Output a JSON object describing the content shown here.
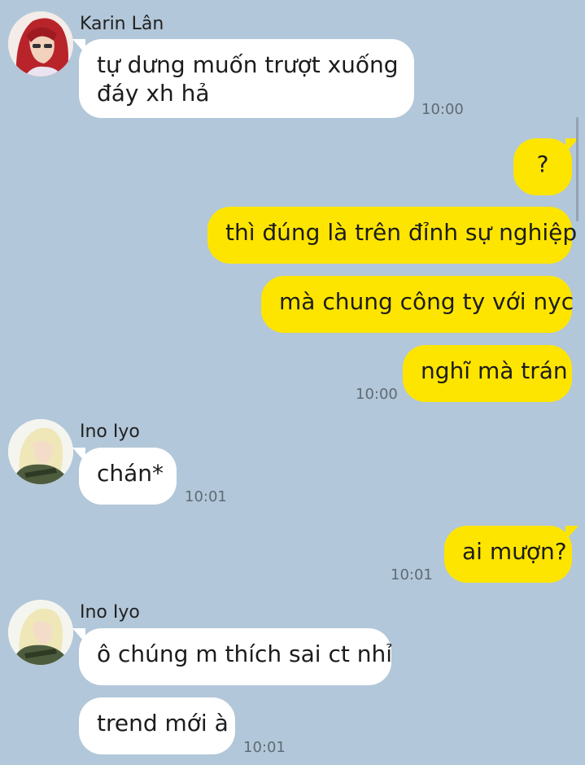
{
  "colors": {
    "background": "#b2c7d9",
    "incoming_bubble": "#ffffff",
    "outgoing_bubble": "#fee500",
    "timestamp": "#5f6b75"
  },
  "messages": [
    {
      "sender": "Karin Lân",
      "avatar": "red-haired-avatar",
      "lines": [
        "tự dưng muốn trượt xuống",
        "đáy xh hả"
      ],
      "time": "10:00"
    },
    {
      "text": "?"
    },
    {
      "text": "thì đúng là trên đỉnh sự nghiệp"
    },
    {
      "text": "mà chung công ty với nyc"
    },
    {
      "text": "nghĩ mà trán",
      "time": "10:00"
    },
    {
      "sender": "Ino Iyo",
      "avatar": "blonde-avatar",
      "text": "chán*",
      "time": "10:01"
    },
    {
      "text": "ai mượn?",
      "time": "10:01"
    },
    {
      "sender": "Ino Iyo",
      "avatar": "blonde-avatar",
      "text": "ô chúng m thích sai ct nhỉ"
    },
    {
      "text": "trend mới à",
      "time": "10:01"
    }
  ]
}
